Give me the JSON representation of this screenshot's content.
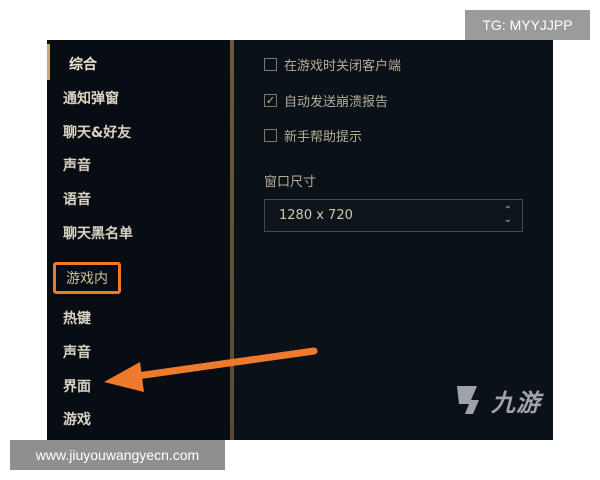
{
  "overlay": {
    "tg_badge": "TG: MYYJJPP",
    "url_badge": "www.jiuyouwangyecn.com",
    "watermark": "九游"
  },
  "sidebar": {
    "items": [
      {
        "label": "综合",
        "active": true
      },
      {
        "label": "通知弹窗"
      },
      {
        "label": "聊天&好友"
      },
      {
        "label": "声音"
      },
      {
        "label": "语音"
      },
      {
        "label": "聊天黑名单"
      },
      {
        "label": "游戏内",
        "section_header": true,
        "highlighted": true
      },
      {
        "label": "热键"
      },
      {
        "label": "声音"
      },
      {
        "label": "界面",
        "arrow_target": true
      },
      {
        "label": "游戏"
      }
    ]
  },
  "main": {
    "checkboxes": [
      {
        "label": "在游戏时关闭客户端",
        "checked": false
      },
      {
        "label": "自动发送崩溃报告",
        "checked": true
      },
      {
        "label": "新手帮助提示",
        "checked": false
      }
    ],
    "window_size": {
      "label": "窗口尺寸",
      "value": "1280 x 720"
    }
  },
  "colors": {
    "highlight_orange": "#f07a2b",
    "gold": "#c8aa6e",
    "background": "#0a1118"
  }
}
